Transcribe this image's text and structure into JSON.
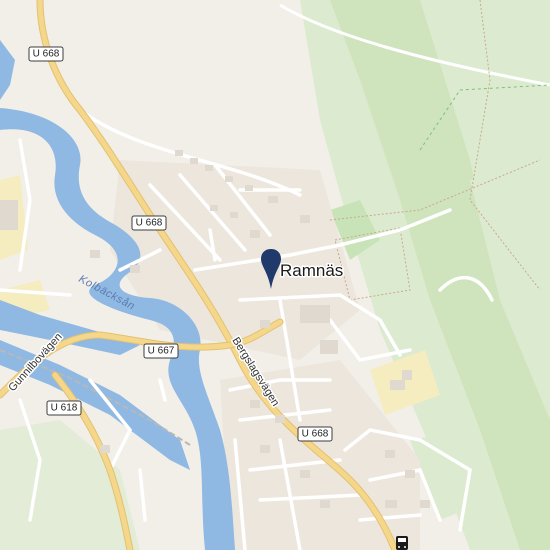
{
  "place": {
    "name": "Ramnäs"
  },
  "water": {
    "river_name": "Kolbäcksån"
  },
  "streets": {
    "bergslagsvagen": "Bergslagsvägen",
    "gunnilbovagen": "Gunnilbovägen"
  },
  "shields": {
    "u668_top": "U 668",
    "u668_mid": "U 668",
    "u668_bottom": "U 668",
    "u667": "U 667",
    "u618": "U 618"
  },
  "colors": {
    "land": "#f2efe9",
    "forest": "#dcebd0",
    "park": "#c9e3b8",
    "water": "#8fb9e3",
    "major_road": "#f5d78b",
    "road_casing": "#e3c170",
    "minor_road": "#ffffff",
    "building": "#e6e0d8",
    "industrial": "#f5ecc0",
    "marker": "#1f3a6b",
    "rail": "#b8b8b8"
  },
  "icons": {
    "location_marker": "map-pin-icon",
    "transit": "bus-stop-icon"
  }
}
